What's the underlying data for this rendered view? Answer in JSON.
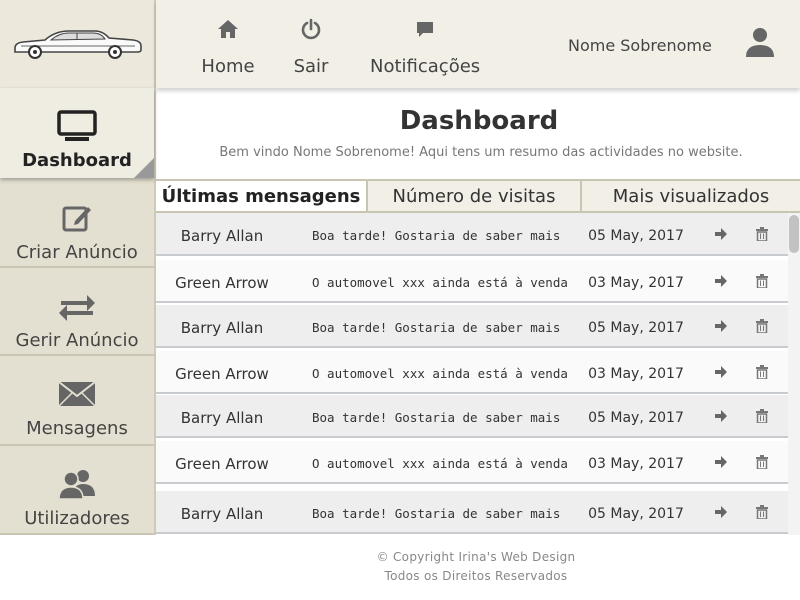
{
  "topnav": {
    "home": "Home",
    "sair": "Sair",
    "notificacoes": "Notificações",
    "user_name": "Nome Sobrenome"
  },
  "sidebar": {
    "items": [
      {
        "label": "Dashboard",
        "icon": "monitor-icon",
        "active": true
      },
      {
        "label": "Criar Anúncio",
        "icon": "edit-icon"
      },
      {
        "label": "Gerir Anúncio",
        "icon": "swap-arrows-icon"
      },
      {
        "label": "Mensagens",
        "icon": "envelope-icon"
      },
      {
        "label": "Utilizadores",
        "icon": "users-icon"
      }
    ]
  },
  "header": {
    "title": "Dashboard",
    "subtitle": "Bem vindo Nome Sobrenome! Aqui tens um resumo das actividades no website."
  },
  "tabs": [
    {
      "label": "Últimas mensagens",
      "active": true
    },
    {
      "label": "Número de visitas"
    },
    {
      "label": "Mais visualizados"
    }
  ],
  "messages": [
    {
      "sender": "Barry Allan",
      "preview": "Boa tarde! Gostaria de saber mais infor-",
      "date": "05 May, 2017"
    },
    {
      "sender": "Green Arrow",
      "preview": "O automovel xxx ainda está à venda?",
      "date": "03 May, 2017"
    },
    {
      "sender": "Barry Allan",
      "preview": "Boa tarde! Gostaria de saber mais infor-",
      "date": "05 May, 2017"
    },
    {
      "sender": "Green Arrow",
      "preview": "O automovel xxx ainda está à venda?",
      "date": "03 May, 2017"
    },
    {
      "sender": "Barry Allan",
      "preview": "Boa tarde! Gostaria de saber mais infor-",
      "date": "05 May, 2017"
    },
    {
      "sender": "Green Arrow",
      "preview": "O automovel xxx ainda está à venda?",
      "date": "03 May, 2017"
    },
    {
      "sender": "Barry Allan",
      "preview": "Boa tarde! Gostaria de saber mais infor-",
      "date": "05 May, 2017"
    }
  ],
  "footer": {
    "copyright": "© Copyright Irina's Web Design",
    "rights": "Todos os Direitos Reservados"
  },
  "colors": {
    "sidebar_bg": "#e4e0d1",
    "topbar_bg": "#f2efe7",
    "icon_gray": "#666666"
  }
}
